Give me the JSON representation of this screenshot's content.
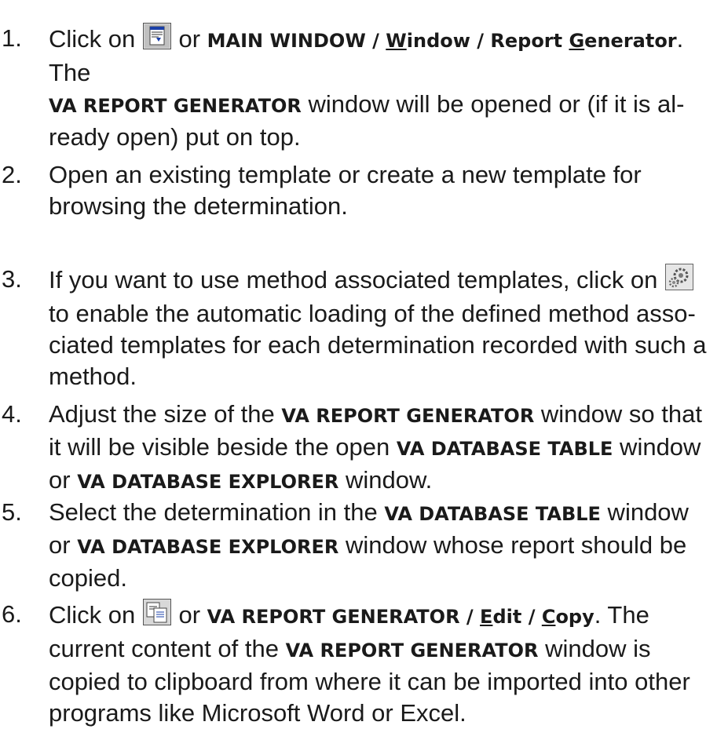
{
  "steps": [
    {
      "number": "1.",
      "parts": [
        {
          "t": "Click on "
        },
        {
          "icon": "report-generator-icon"
        },
        {
          "t": " or "
        },
        {
          "ui": "MAIN WINDOW / "
        },
        {
          "ui": "W",
          "u": true
        },
        {
          "ui": "indow / Report "
        },
        {
          "ui": "G",
          "u": true
        },
        {
          "ui": "enerator"
        },
        {
          "t": ". The"
        },
        {
          "br": true
        },
        {
          "ui": "VA REPORT GENERATOR"
        },
        {
          "t": " window will be opened or (if it is al-"
        },
        {
          "br": true
        },
        {
          "t": "ready open) put on top."
        }
      ]
    },
    {
      "number": "2.",
      "parts": [
        {
          "t": "Open an existing template or create a new template for"
        },
        {
          "br": true
        },
        {
          "t": "browsing the determination."
        }
      ]
    },
    {
      "number": "3.",
      "parts": [
        {
          "t": "If you want to use method associated templates, click on "
        },
        {
          "icon": "gears-icon"
        },
        {
          "br": true
        },
        {
          "t": "to enable the automatic loading of the defined method asso-"
        },
        {
          "br": true
        },
        {
          "t": "ciated templates for each determination recorded with such a"
        },
        {
          "br": true
        },
        {
          "t": "method."
        }
      ]
    },
    {
      "number": "4.",
      "parts": [
        {
          "t": "Adjust the size of the "
        },
        {
          "ui": "VA REPORT GENERATOR"
        },
        {
          "t": " window so that"
        },
        {
          "br": true
        },
        {
          "t": "it will be visible beside the open "
        },
        {
          "ui": "VA DATABASE TABLE"
        },
        {
          "t": " window"
        },
        {
          "br": true
        },
        {
          "t": "or "
        },
        {
          "ui": "VA DATABASE EXPLORER"
        },
        {
          "t": " window."
        }
      ]
    },
    {
      "number": "5.",
      "parts": [
        {
          "t": "Select the determination in the "
        },
        {
          "ui": "VA DATABASE TABLE"
        },
        {
          "t": " window"
        },
        {
          "br": true
        },
        {
          "t": "or "
        },
        {
          "ui": "VA DATABASE EXPLORER"
        },
        {
          "t": " window whose report should be"
        },
        {
          "br": true
        },
        {
          "t": "copied."
        }
      ]
    },
    {
      "number": "6.",
      "parts": [
        {
          "t": "Click on "
        },
        {
          "icon": "copy-icon"
        },
        {
          "t": " or "
        },
        {
          "ui": "VA REPORT GENERATOR / "
        },
        {
          "ui": "E",
          "u": true
        },
        {
          "ui": "dit / "
        },
        {
          "ui": "C",
          "u": true
        },
        {
          "ui": "opy"
        },
        {
          "t": ". The"
        },
        {
          "br": true
        },
        {
          "t": "current content of the "
        },
        {
          "ui": "VA REPORT GENERATOR"
        },
        {
          "t": " window is"
        },
        {
          "br": true
        },
        {
          "t": "copied to clipboard from where it can be imported into other"
        },
        {
          "br": true
        },
        {
          "t": "programs like Microsoft Word or Excel."
        }
      ]
    }
  ]
}
